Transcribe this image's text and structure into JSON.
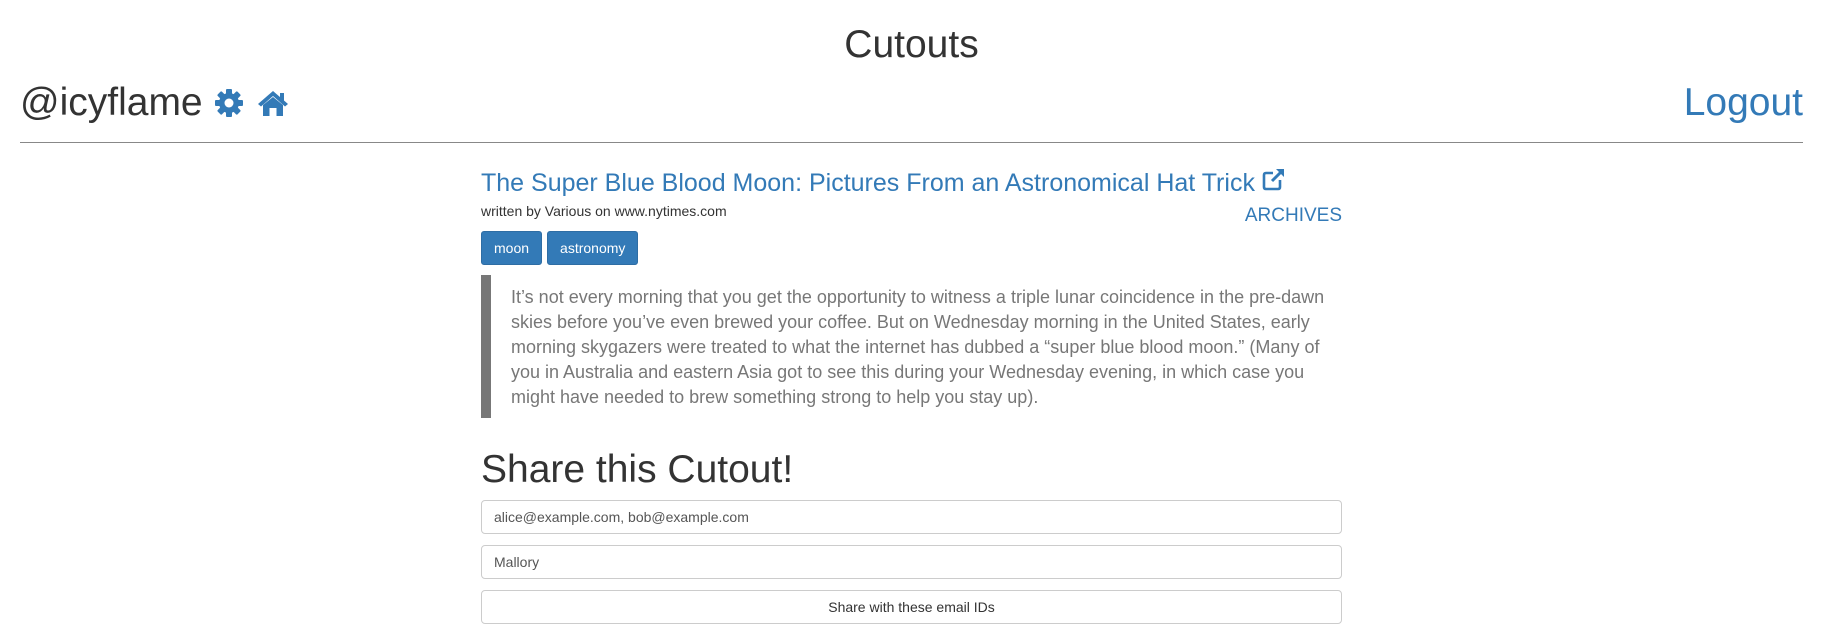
{
  "header": {
    "title": "Cutouts",
    "username": "@icyflame",
    "logout_label": "Logout",
    "icons": [
      "gear-icon",
      "home-icon"
    ]
  },
  "article": {
    "title": "The Super Blue Blood Moon: Pictures From an Astronomical Hat Trick",
    "byline": "written by Various on www.nytimes.com",
    "archives_label": "ARCHIVES",
    "tags": [
      "moon",
      "astronomy"
    ],
    "quote": "It’s not every morning that you get the opportunity to witness a triple lunar coincidence in the pre-dawn skies before you’ve even brewed your coffee. But on Wednesday morning in the United States, early morning skygazers were treated to what the internet has dubbed a “super blue blood moon.” (Many of you in Australia and eastern Asia got to see this during your Wednesday evening, in which case you might have needed to brew something strong to help you stay up)."
  },
  "share": {
    "heading": "Share this Cutout!",
    "emails_placeholder": "alice@example.com, bob@example.com",
    "name_placeholder": "Mallory",
    "button_label": "Share with these email IDs"
  },
  "colors": {
    "link": "#337ab7",
    "tag_bg": "#337ab7",
    "quote_border": "#777777",
    "text": "#333333"
  }
}
